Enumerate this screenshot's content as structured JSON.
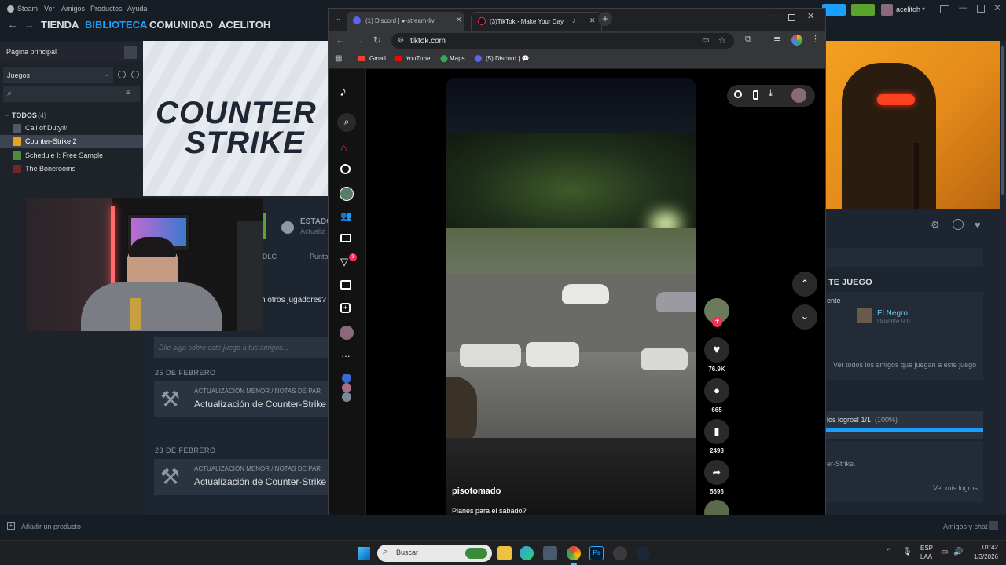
{
  "steam": {
    "menu": [
      "Steam",
      "Ver",
      "Amigos",
      "Productos",
      "Ayuda"
    ],
    "nav": [
      "TIENDA",
      "BIBLIOTECA",
      "COMUNIDAD",
      "ACELITOH"
    ],
    "username": "acelitoh",
    "home_label": "Página principal",
    "filter_label": "Juegos",
    "all_label": "TODOS",
    "all_count": "(4)",
    "games": [
      "Call of Duty®",
      "Counter-Strike 2",
      "Schedule I: Free Sample",
      "The Bonerooms"
    ],
    "selected_game": "Counter-Strike 2",
    "banner_line1": "COUNTER",
    "banner_line2": "STRIKE",
    "status_label": "ESTADO",
    "status_sub": "Actualiz",
    "tab_dlc": "DLC",
    "tab_points": "Punto",
    "friends_question": "n otros jugadores?",
    "comment_placeholder": "Dile algo sobre este juego a tus amigos...",
    "news": [
      {
        "date": "25 DE FEBRERO",
        "category": "ACTUALIZACIÓN MENOR / NOTAS DE PAR",
        "title": "Actualización de Counter-Strike"
      },
      {
        "date": "23 DE FEBRERO",
        "category": "ACTUALIZACIÓN MENOR / NOTAS DE PAR",
        "title": "Actualización de Counter-Strike"
      }
    ],
    "right": {
      "section_title": "TE JUEGO",
      "recent_label": "ente",
      "friend_name": "El Negro",
      "friend_time": "Durante 9 h",
      "see_all_friends": "Ver todos los amigos que juegan a este juego",
      "achievements": "los logros! 1/1",
      "achievements_pct": "(100%)",
      "ach_progress": 1.0,
      "strike_text": "er-Strike.",
      "see_achievements": "Ver mis logros"
    },
    "add_product": "Añadir un producto",
    "friends_chat": "Amigos y chat"
  },
  "browser": {
    "tabs": [
      {
        "title": "(1) Discord | ●-stream-liv"
      },
      {
        "title": "(3)TikTok - Make Your Day"
      }
    ],
    "url": "tiktok.com",
    "bookmarks": [
      "Gmail",
      "YouTube",
      "Maps",
      "(5) Discord | 💬"
    ],
    "tiktok": {
      "username": "pisotomado",
      "caption": "Planes para el sabado?",
      "likes": "76.9K",
      "comments": "665",
      "saves": "2493",
      "shares": "5693",
      "inbox_badge": "3"
    }
  },
  "taskbar": {
    "search_placeholder": "Buscar",
    "lang_line1": "ESP",
    "lang_line2": "LAA",
    "time": "01:42",
    "date": "1/3/2026"
  },
  "colors": {
    "steam_blue": "#1a9fff",
    "tiktok_red": "#fe2c55",
    "cs_orange": "#f3a020"
  }
}
